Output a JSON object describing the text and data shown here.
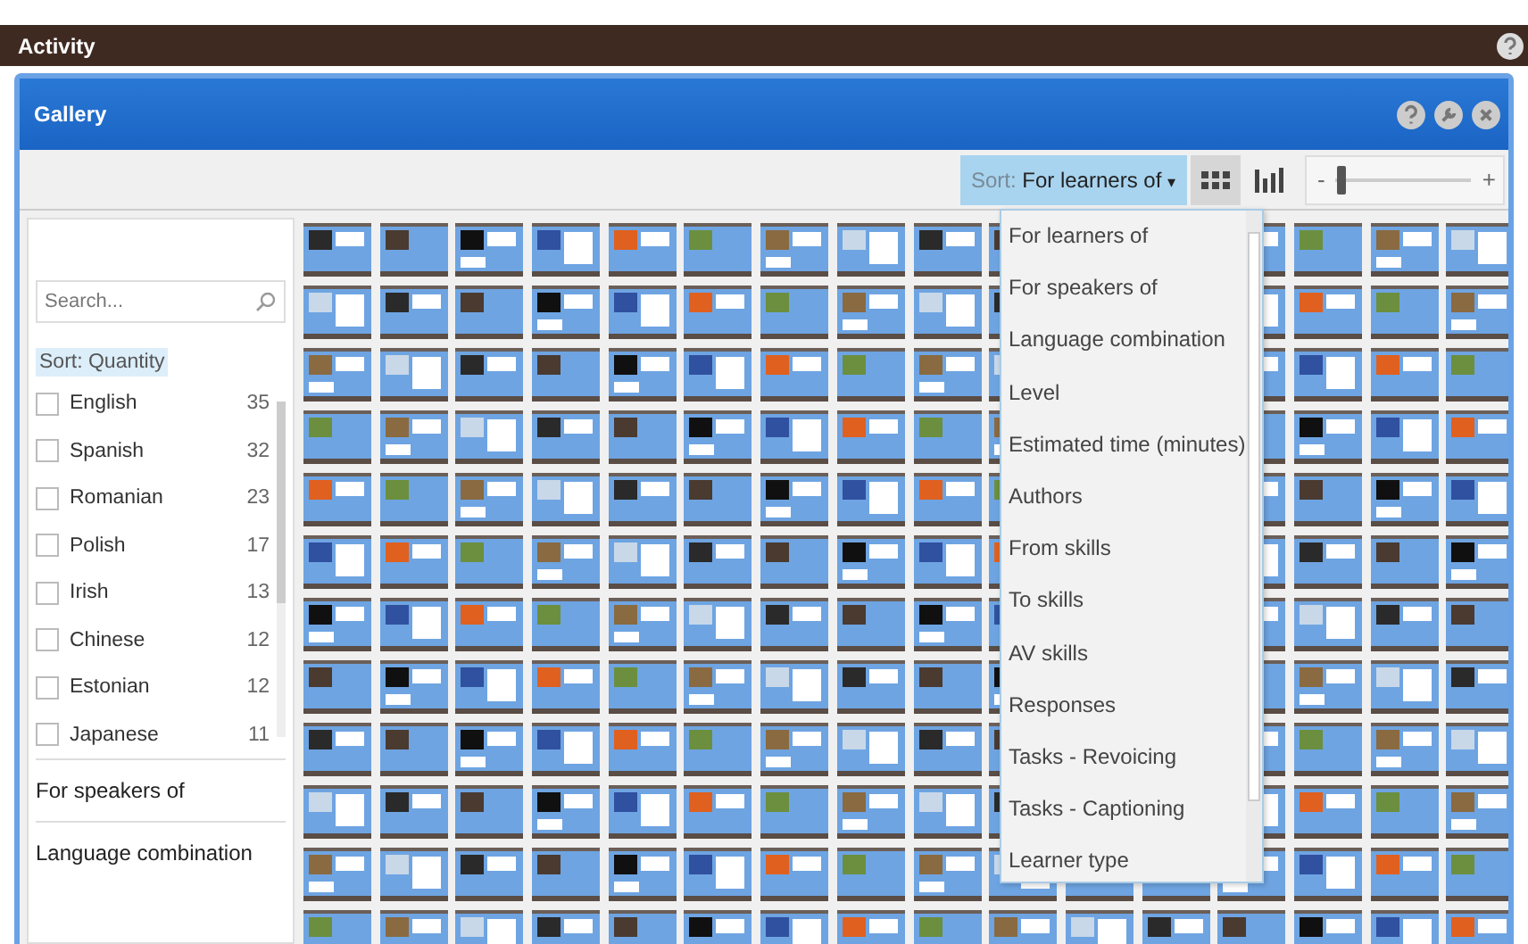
{
  "app_bar": {
    "title": "Activity"
  },
  "window": {
    "title": "Gallery"
  },
  "toolbar": {
    "sort": {
      "prefix": "Sort:",
      "value": "For learners of",
      "caret": "▾",
      "open": true
    },
    "views": [
      {
        "kind": "grid",
        "selected": true
      },
      {
        "kind": "bars",
        "selected": false
      }
    ],
    "zoom": {
      "minus": "-",
      "plus": "+",
      "level": 0.05
    }
  },
  "sort_menu": {
    "items": [
      "For learners of",
      "For speakers of",
      "Language combination",
      "Level",
      "Estimated time (minutes)",
      "Authors",
      "From skills",
      "To skills",
      "AV skills",
      "Responses",
      "Tasks - Revoicing",
      "Tasks - Captioning",
      "Learner type"
    ]
  },
  "filters": {
    "search": {
      "placeholder": "Search..."
    },
    "sort_label": "Sort: Quantity",
    "languages": [
      {
        "name": "English",
        "count": "35",
        "checked": false
      },
      {
        "name": "Spanish",
        "count": "32",
        "checked": false
      },
      {
        "name": "Romanian",
        "count": "23",
        "checked": false
      },
      {
        "name": "Polish",
        "count": "17",
        "checked": false
      },
      {
        "name": "Irish",
        "count": "13",
        "checked": false
      },
      {
        "name": "Chinese",
        "count": "12",
        "checked": false
      },
      {
        "name": "Estonian",
        "count": "12",
        "checked": false
      },
      {
        "name": "Japanese",
        "count": "11",
        "checked": false
      }
    ],
    "sections": [
      "For speakers of",
      "Language combination"
    ]
  }
}
